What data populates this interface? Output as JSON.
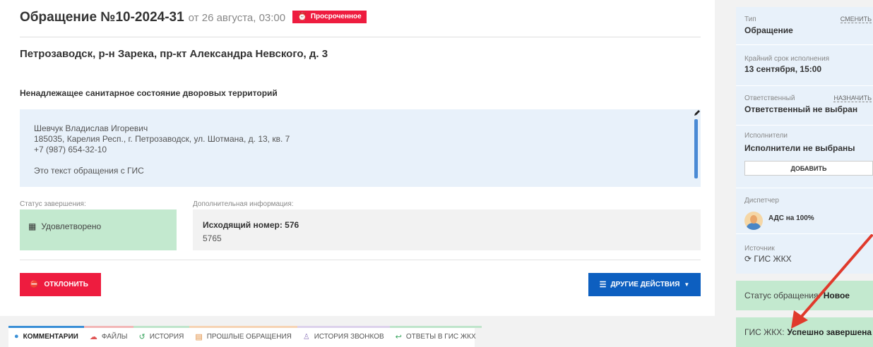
{
  "header": {
    "title": "Обращение №10-2024-31",
    "date": "от 26 августа, 03:00",
    "overdue_badge": "Просроченное"
  },
  "address": "Петрозаводск, р-н Зарека, пр-кт Александра Невского, д. 3",
  "subject": "Ненадлежащее санитарное состояние дворовых территорий",
  "request_text": {
    "name": "Шевчук Владислав Игоревич",
    "postal_address": "185035, Карелия Респ., г. Петрозаводск, ул. Шотмана, д. 13, кв. 7",
    "phone": "+7 (987) 654-32-10",
    "body": "Это текст обращения с ГИС"
  },
  "completion": {
    "label": "Статус завершения:",
    "value": "Удовлетворено"
  },
  "extra_info": {
    "label": "Дополнительная информация:",
    "outgoing_number": "Исходящий номер: 576",
    "value": "5765"
  },
  "buttons": {
    "reject": "ОТКЛОНИТЬ",
    "other_actions": "ДРУГИЕ ДЕЙСТВИЯ"
  },
  "tabs": [
    {
      "label": "КОММЕНТАРИИ",
      "icon": "comment-icon",
      "color": "#3a8fd6",
      "active": true
    },
    {
      "label": "ФАЙЛЫ",
      "icon": "cloud-icon",
      "color": "#f2b7b7",
      "active": false
    },
    {
      "label": "ИСТОРИЯ",
      "icon": "history-icon",
      "color": "#bfe5cb",
      "active": false
    },
    {
      "label": "ПРОШЛЫЕ ОБРАЩЕНИЯ",
      "icon": "clipboard-icon",
      "color": "#f6d4b4",
      "active": false
    },
    {
      "label": "ИСТОРИЯ ЗВОНКОВ",
      "icon": "user-icon",
      "color": "#ddd2ec",
      "active": false
    },
    {
      "label": "ОТВЕТЫ В ГИС ЖКХ",
      "icon": "reply-icon",
      "color": "#bfe5cb",
      "active": false
    }
  ],
  "sidebar": {
    "type_label": "Тип",
    "type_action": "СМЕНИТЬ",
    "type_value": "Обращение",
    "deadline_label": "Крайний срок исполнения",
    "deadline_value": "13 сентября, 15:00",
    "responsible_label": "Ответственный",
    "responsible_action": "НАЗНАЧИТЬ",
    "responsible_value": "Ответственный не выбран",
    "executors_label": "Исполнители",
    "executors_value": "Исполнители не выбраны",
    "add_button": "ДОБАВИТЬ",
    "dispatcher_label": "Диспетчер",
    "dispatcher_value": "АДС на 100%",
    "source_label": "Источник",
    "source_value": "ГИС ЖКХ"
  },
  "request_status": {
    "label": "Статус обращения:",
    "value": "Новое"
  },
  "gis_status": {
    "label": "ГИС ЖКХ:",
    "value": "Успешно завершена"
  },
  "colors": {
    "accent_red": "#ee1c3f",
    "accent_blue": "#0d5fc0",
    "success_green": "#c3e9cf",
    "info_blue": "#e8f1fa"
  }
}
